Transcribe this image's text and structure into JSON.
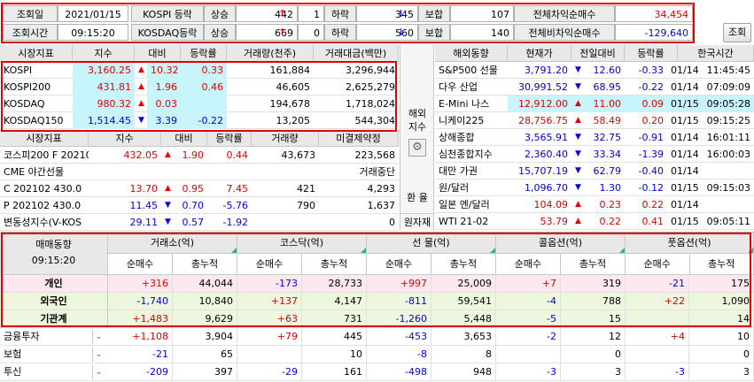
{
  "top": {
    "date_label": "조회일",
    "date_value": "2021/01/15",
    "time_label": "조회시간",
    "time_value": "09:15:20",
    "kospi_label": "KOSPI 등락",
    "kosdaq_label": "KOSDAQ등락",
    "rise_label": "상승",
    "fall_label": "하락",
    "flat_label": "보합",
    "kospi_rise": "442",
    "kospi_up_arrow": "↑",
    "kospi_up_count": "1",
    "kospi_fall": "345",
    "kospi_down_arrow": "↓",
    "kospi_flat": "107",
    "kosdaq_rise": "669",
    "kosdaq_up_arrow": "↑",
    "kosdaq_up_count": "0",
    "kosdaq_fall": "560",
    "kosdaq_down_arrow": "↓",
    "kosdaq_flat": "140",
    "arb_label": "전체차익순매수",
    "arb_value": "34,454",
    "nonarb_label": "전체비차익순매수",
    "nonarb_value": "-129,640",
    "query_button": "조회"
  },
  "index_table": {
    "headers": [
      "시장지표",
      "지수",
      "대비",
      "등락률",
      "거래량(천주)",
      "거래대금(백만)"
    ],
    "rows": [
      {
        "name": "KOSPI",
        "index": "3,160.25",
        "dir": "▲",
        "diff": "10.32",
        "rate": "0.33",
        "volume": "161,884",
        "amount": "3,296,944",
        "color": "red"
      },
      {
        "name": "KOSPI200",
        "index": "431.81",
        "dir": "▲",
        "diff": "1.96",
        "rate": "0.46",
        "volume": "46,605",
        "amount": "2,625,279",
        "color": "red"
      },
      {
        "name": "KOSDAQ",
        "index": "980.32",
        "dir": "▲",
        "diff": "0.03",
        "rate": "",
        "volume": "194,678",
        "amount": "1,718,024",
        "color": "red"
      },
      {
        "name": "KOSDAQ150",
        "index": "1,514.45",
        "dir": "▼",
        "diff": "3.39",
        "rate": "-0.22",
        "volume": "13,205",
        "amount": "544,304",
        "color": "blue"
      }
    ]
  },
  "futures_table": {
    "headers": [
      "시장지표",
      "지수",
      "대비",
      "등락률",
      "거래량",
      "미결제약정"
    ],
    "rows": [
      {
        "name": "코스피200 F 202103",
        "index": "432.05",
        "dir": "▲",
        "diff": "1.90",
        "rate": "0.44",
        "volume": "43,673",
        "oi": "223,568",
        "color": "red"
      },
      {
        "name": "CME 야간선물",
        "index": "",
        "dir": "",
        "diff": "",
        "rate": "",
        "volume": "",
        "oi": "거래중단",
        "color": "black"
      },
      {
        "name": "C 202102 430.0",
        "index": "13.70",
        "dir": "▲",
        "diff": "0.95",
        "rate": "7.45",
        "volume": "421",
        "oi": "4,293",
        "color": "red"
      },
      {
        "name": "P 202102 430.0",
        "index": "11.45",
        "dir": "▼",
        "diff": "0.70",
        "rate": "-5.76",
        "volume": "790",
        "oi": "1,637",
        "color": "blue"
      },
      {
        "name": "변동성지수(V-KOS",
        "index": "29.11",
        "dir": "▼",
        "diff": "0.57",
        "rate": "-1.92",
        "volume": "",
        "oi": "0",
        "color": "blue"
      }
    ]
  },
  "side_tabs": {
    "overseas": "해외\n지수",
    "fx": "환 율",
    "raw": "원자재"
  },
  "world_table": {
    "headers": [
      "해외동향",
      "현재가",
      "전일대비",
      "등락률",
      "한국시간"
    ],
    "rows": [
      {
        "name": "S&P500 선물",
        "price": "3,791.20",
        "dir": "▼",
        "diff": "12.60",
        "rate": "-0.33",
        "date": "01/14",
        "time": "11:45:45",
        "color": "blue",
        "hl": false
      },
      {
        "name": "다우 산업",
        "price": "30,991.52",
        "dir": "▼",
        "diff": "68.95",
        "rate": "-0.22",
        "date": "01/14",
        "time": "07:09:09",
        "color": "blue",
        "hl": false
      },
      {
        "name": "E-Mini 나스",
        "price": "12,912.00",
        "dir": "▲",
        "diff": "11.00",
        "rate": "0.09",
        "date": "01/15",
        "time": "09:05:28",
        "color": "red",
        "hl": true
      },
      {
        "name": "니케이225",
        "price": "28,756.75",
        "dir": "▲",
        "diff": "58.49",
        "rate": "0.20",
        "date": "01/15",
        "time": "09:15:25",
        "color": "red",
        "hl": false
      },
      {
        "name": "상해종합",
        "price": "3,565.91",
        "dir": "▼",
        "diff": "32.75",
        "rate": "-0.91",
        "date": "01/14",
        "time": "16:01:11",
        "color": "blue",
        "hl": false
      },
      {
        "name": "심천종합지수",
        "price": "2,360.40",
        "dir": "▼",
        "diff": "33.34",
        "rate": "-1.39",
        "date": "01/14",
        "time": "16:00:03",
        "color": "blue",
        "hl": false
      },
      {
        "name": "대만 가권",
        "price": "15,707.19",
        "dir": "▼",
        "diff": "62.79",
        "rate": "-0.40",
        "date": "01/14",
        "time": "",
        "color": "blue",
        "hl": false
      },
      {
        "name": "원/달러",
        "price": "1,096.70",
        "dir": "▼",
        "diff": "1.30",
        "rate": "-0.12",
        "date": "01/15",
        "time": "09:15:03",
        "color": "blue",
        "hl": false
      },
      {
        "name": "일본 엔/달러",
        "price": "104.09",
        "dir": "▲",
        "diff": "0.23",
        "rate": "0.22",
        "date": "01/14",
        "time": "",
        "color": "red",
        "hl": false
      },
      {
        "name": "WTI 21-02",
        "price": "53.79",
        "dir": "▲",
        "diff": "0.22",
        "rate": "0.41",
        "date": "01/15",
        "time": "09:05:11",
        "color": "red",
        "hl": false
      }
    ]
  },
  "trading": {
    "title": "매매동향",
    "time": "09:15:20",
    "groups": [
      "거래소(억)",
      "코스닥(억)",
      "선  물(억)",
      "콜옵션(억)",
      "풋옵션(억)"
    ],
    "sub": [
      "순매수",
      "총누적"
    ],
    "rows": [
      {
        "name": "개인",
        "vals": [
          "+316",
          "44,044",
          "-173",
          "28,733",
          "+997",
          "25,009",
          "+7",
          "319",
          "-21",
          "175"
        ]
      },
      {
        "name": "외국인",
        "vals": [
          "-1,740",
          "10,840",
          "+137",
          "4,147",
          "-811",
          "59,541",
          "-4",
          "788",
          "+22",
          "1,090"
        ]
      },
      {
        "name": "기관계",
        "vals": [
          "+1,483",
          "9,629",
          "+63",
          "731",
          "-1,260",
          "5,448",
          "-5",
          "15",
          "",
          "14"
        ]
      },
      {
        "name": "금융투자",
        "vals": [
          "+1,108",
          "3,904",
          "+79",
          "445",
          "-453",
          "3,653",
          "-2",
          "12",
          "+4",
          "10"
        ]
      },
      {
        "name": "보험",
        "vals": [
          "-21",
          "65",
          "",
          "10",
          "-8",
          "8",
          "",
          "0",
          "",
          "0"
        ]
      },
      {
        "name": "투신",
        "vals": [
          "-209",
          "397",
          "-29",
          "161",
          "-498",
          "948",
          "-3",
          "3",
          "-3",
          "3"
        ]
      }
    ]
  },
  "colors": {
    "up": "#e00000",
    "down": "#0000e0",
    "highlight": "#c8f4fb",
    "frame": "#e00000",
    "header": "#e8e8e8"
  },
  "icons": {
    "settings": "gear-icon",
    "dropdown": "chevron-down-icon"
  }
}
